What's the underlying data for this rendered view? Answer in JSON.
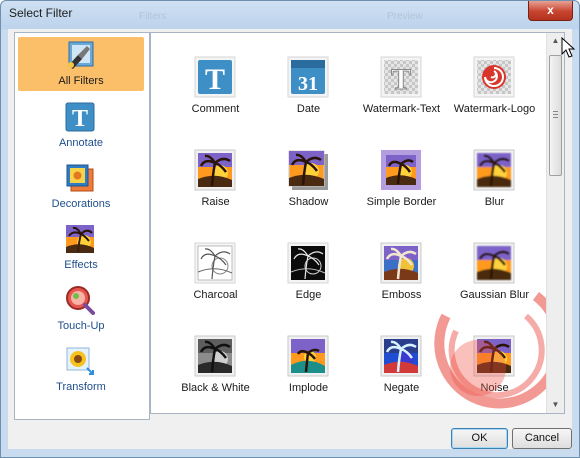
{
  "window": {
    "title": "Select Filter",
    "ghost_left": "Filters",
    "ghost_right": "Preview",
    "close_glyph": "x"
  },
  "categories": [
    {
      "label": "All Filters",
      "icon": "brush-icon",
      "selected": true
    },
    {
      "label": "Annotate",
      "icon": "text-T-icon",
      "selected": false
    },
    {
      "label": "Decorations",
      "icon": "frame-icon",
      "selected": false
    },
    {
      "label": "Effects",
      "icon": "palm-icon",
      "selected": false
    },
    {
      "label": "Touch-Up",
      "icon": "magnifier-icon",
      "selected": false
    },
    {
      "label": "Transform",
      "icon": "transform-flower-icon",
      "selected": false
    }
  ],
  "filters": [
    {
      "label": "Comment",
      "icon": "text-T-icon"
    },
    {
      "label": "Date",
      "icon": "calendar-icon",
      "digits": "31"
    },
    {
      "label": "Watermark-Text",
      "icon": "watermark-text-icon"
    },
    {
      "label": "Watermark-Logo",
      "icon": "watermark-logo-icon"
    },
    {
      "label": "Raise",
      "icon": "palm-icon"
    },
    {
      "label": "Shadow",
      "icon": "palm-icon"
    },
    {
      "label": "Simple Border",
      "icon": "palm-icon"
    },
    {
      "label": "Blur",
      "icon": "palm-icon"
    },
    {
      "label": "Charcoal",
      "icon": "palm-sketch-icon"
    },
    {
      "label": "Edge",
      "icon": "palm-edge-icon"
    },
    {
      "label": "Emboss",
      "icon": "palm-icon"
    },
    {
      "label": "Gaussian Blur",
      "icon": "palm-icon"
    },
    {
      "label": "Black & White",
      "icon": "palm-bw-icon"
    },
    {
      "label": "Implode",
      "icon": "palm-icon"
    },
    {
      "label": "Negate",
      "icon": "palm-negative-icon"
    },
    {
      "label": "Noise",
      "icon": "palm-icon"
    }
  ],
  "buttons": {
    "ok": "OK",
    "cancel": "Cancel"
  }
}
